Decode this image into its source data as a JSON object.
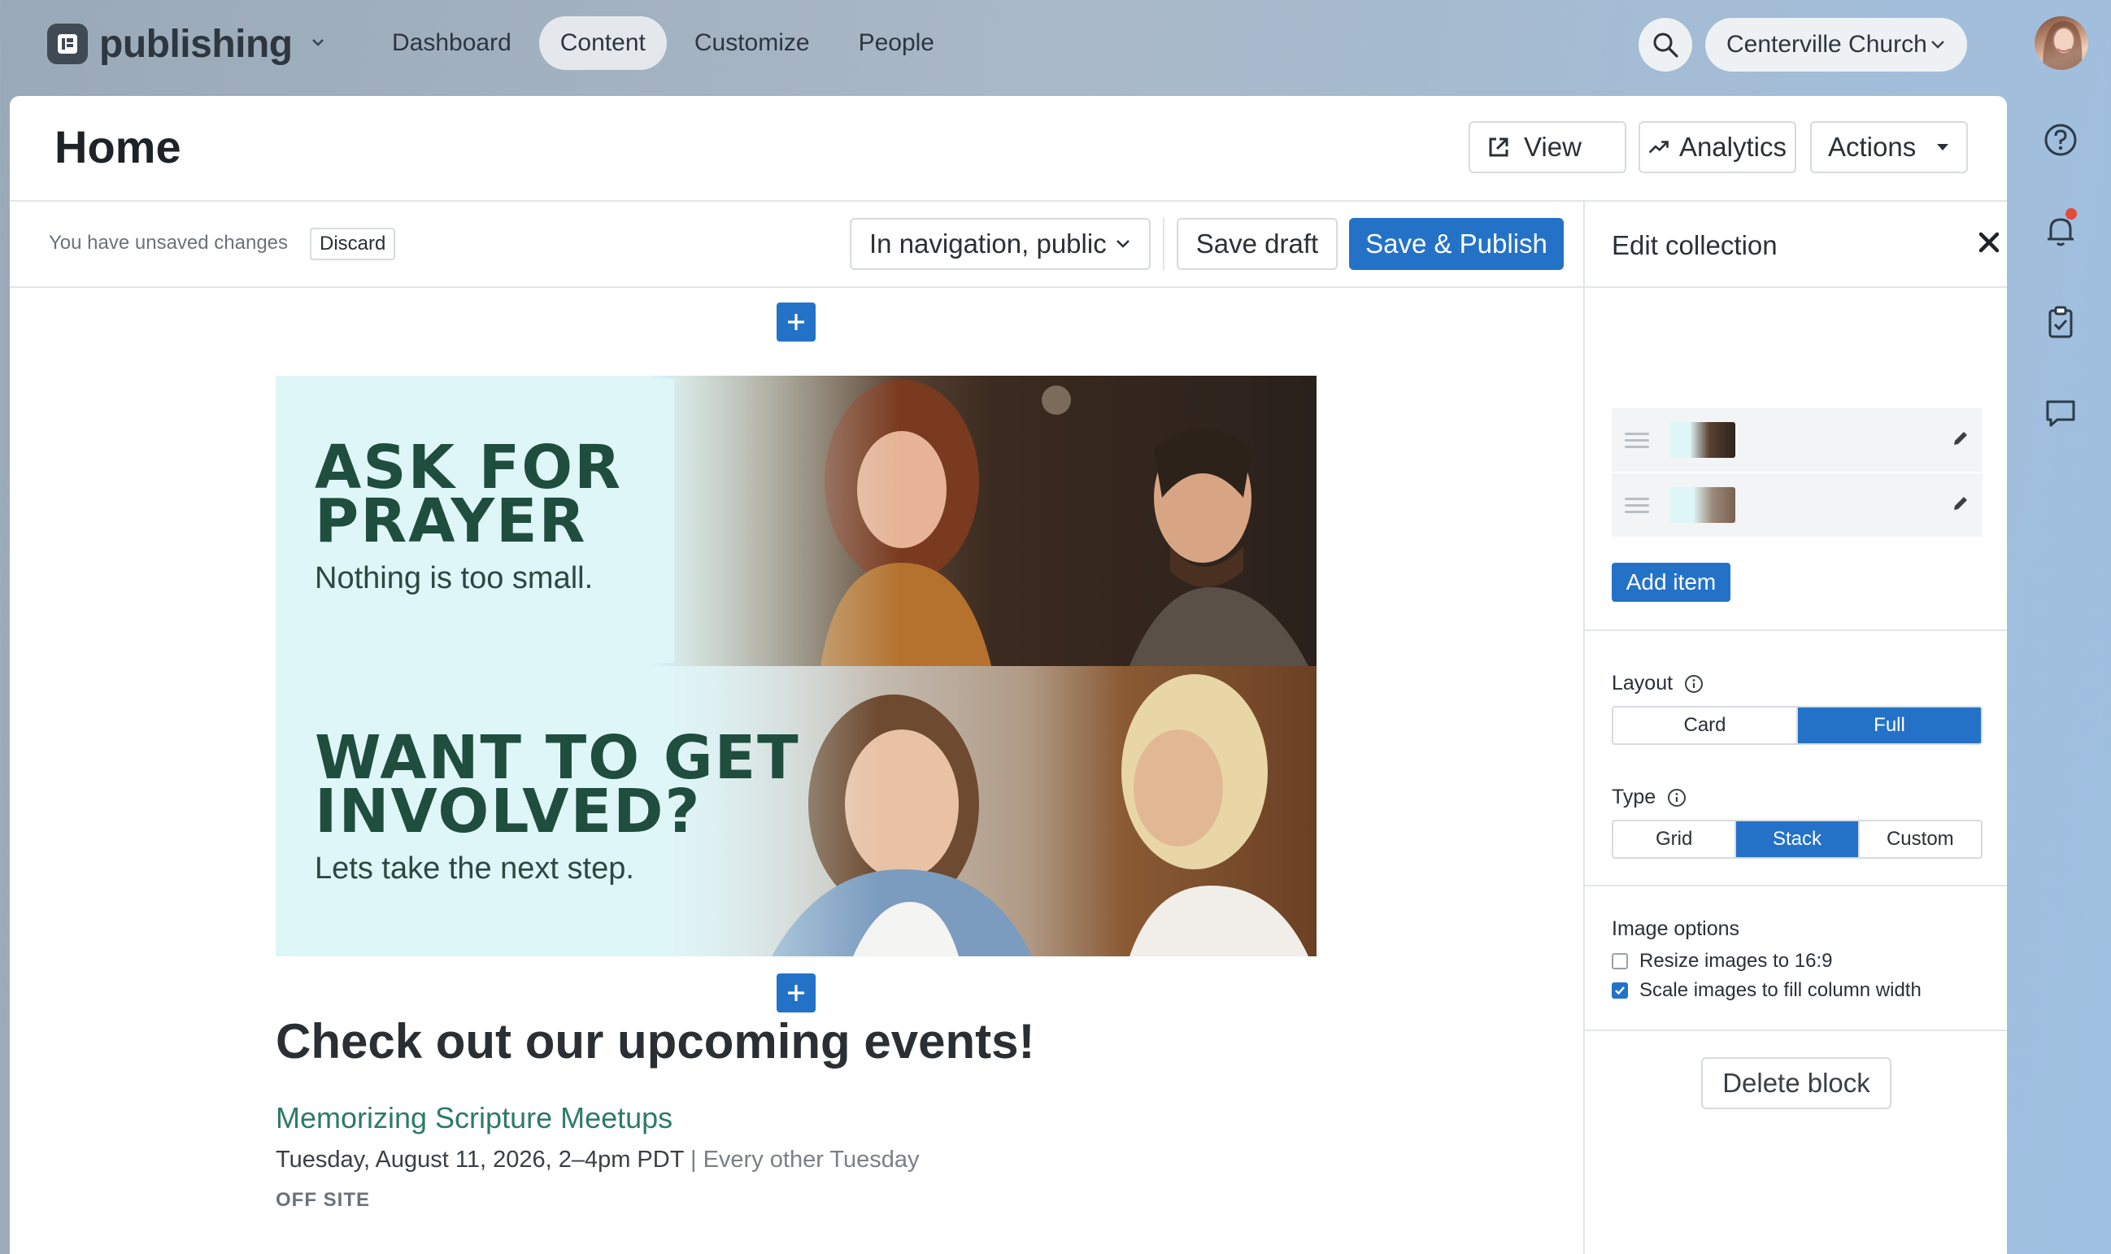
{
  "topbar": {
    "brand": "publishing",
    "nav": [
      "Dashboard",
      "Content",
      "Customize",
      "People"
    ],
    "active_nav": "Content",
    "organization": "Centerville Church"
  },
  "header": {
    "title": "Home",
    "view_label": "View",
    "analytics_label": "Analytics",
    "actions_label": "Actions"
  },
  "toolbar": {
    "unsaved_text": "You have unsaved changes",
    "discard_label": "Discard",
    "visibility": "In navigation, public",
    "save_draft_label": "Save draft",
    "publish_label": "Save & Publish"
  },
  "banners": [
    {
      "headline_1": "ASK FOR",
      "headline_2": "PRAYER",
      "subtext": "Nothing is too small.",
      "selected": true
    },
    {
      "headline_1": "WANT TO GET",
      "headline_2": "INVOLVED?",
      "subtext": "Lets take the next step.",
      "selected": false
    }
  ],
  "events": {
    "heading": "Check out our upcoming events!",
    "items": [
      {
        "name": "Memorizing Scripture Meetups",
        "date": "Tuesday, August 11, 2026, 2–4pm PDT",
        "recurrence": "| Every other Tuesday",
        "location": "OFF SITE"
      }
    ]
  },
  "sidebar": {
    "title": "Edit collection",
    "add_item_label": "Add item",
    "layout_label": "Layout",
    "layout_options": [
      "Card",
      "Full"
    ],
    "layout_selected": "Full",
    "type_label": "Type",
    "type_options": [
      "Grid",
      "Stack",
      "Custom"
    ],
    "type_selected": "Stack",
    "image_options_label": "Image options",
    "image_options": [
      {
        "label": "Resize images to 16:9",
        "checked": false
      },
      {
        "label": "Scale images to fill column width",
        "checked": true
      }
    ],
    "delete_label": "Delete block"
  },
  "colors": {
    "accent": "#2472c8",
    "headline_green": "#1f4d3e",
    "event_link": "#2e7a68",
    "notification": "#e24a3b"
  }
}
